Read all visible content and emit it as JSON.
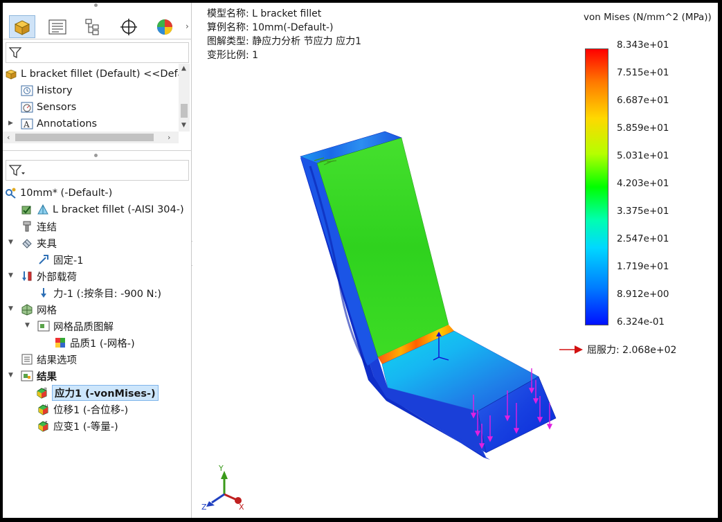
{
  "left_panel": {
    "tabs": [
      {
        "name": "feature-manager",
        "icon": "part-icon",
        "active": true
      },
      {
        "name": "property-manager",
        "icon": "property-icon"
      },
      {
        "name": "configuration-manager",
        "icon": "config-icon"
      },
      {
        "name": "dimxpert-manager",
        "icon": "target-icon"
      },
      {
        "name": "display-manager",
        "icon": "display-icon"
      }
    ],
    "feature_tree": {
      "root": "L bracket  fillet (Default) <<Default",
      "items": [
        "History",
        "Sensors",
        "Annotations"
      ]
    },
    "study_tree": {
      "study": "10mm* (-Default-)",
      "items": [
        "L bracket  fillet (-AISI 304-)",
        "连结",
        "夹具",
        "固定-1",
        "外部载荷",
        "力-1 (:按条目: -900 N:)",
        "网格",
        "网格品质图解",
        "品质1 (-网格-)",
        "结果选项",
        "结果",
        "应力1 (-vonMises-)",
        "位移1 (-合位移-)",
        "应变1 (-等量-)"
      ]
    }
  },
  "viewport": {
    "info": {
      "model_name_label": "模型名称:",
      "model_name": "L bracket  fillet",
      "study_name_label": "算例名称:",
      "study_name": "10mm(-Default-)",
      "plot_type_label": "图解类型:",
      "plot_type": "静应力分析 节应力 应力1",
      "deform_scale_label": "变形比例:",
      "deform_scale": "1"
    },
    "legend": {
      "title": "von Mises (N/mm^2 (MPa))",
      "ticks": [
        "8.343e+01",
        "7.515e+01",
        "6.687e+01",
        "5.859e+01",
        "5.031e+01",
        "4.203e+01",
        "3.375e+01",
        "2.547e+01",
        "1.719e+01",
        "8.912e+00",
        "6.324e-01"
      ],
      "yield_label": "屈服力: 2.068e+02",
      "colors": [
        "#ff0000",
        "#ffd800",
        "#00ff00",
        "#00d8ff",
        "#0010ff"
      ]
    },
    "triad": {
      "x": "X",
      "y": "Y",
      "z": "Z"
    }
  }
}
